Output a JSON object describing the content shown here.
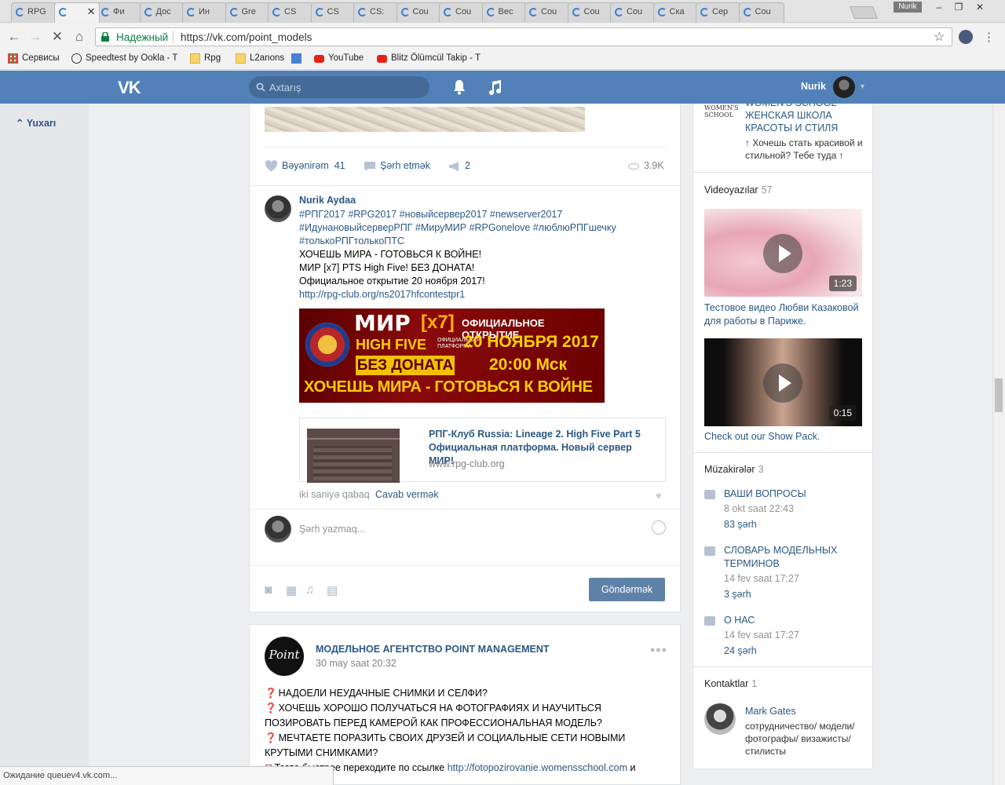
{
  "browser": {
    "tabs": [
      {
        "label": "RPG"
      },
      {
        "label": ""
      },
      {
        "label": "Фи"
      },
      {
        "label": "Дос"
      },
      {
        "label": "Ин"
      },
      {
        "label": "Gre"
      },
      {
        "label": "CS"
      },
      {
        "label": "CS"
      },
      {
        "label": "CS:"
      },
      {
        "label": "Cou"
      },
      {
        "label": "Cou"
      },
      {
        "label": "Bec"
      },
      {
        "label": "Cou"
      },
      {
        "label": "Cou"
      },
      {
        "label": "Cou"
      },
      {
        "label": "Ска"
      },
      {
        "label": "Сер"
      },
      {
        "label": "Cou"
      }
    ],
    "user_badge": "Nurik",
    "secure_label": "Надежный",
    "url": "https://vk.com/point_models",
    "bookmarks": [
      "Сервисы",
      "Speedtest by Ookla - T",
      "Rpg",
      "L2anons",
      "",
      "YouTube",
      "Blitz Ölümcül Takip - T"
    ],
    "status": "Ожидание queuev4.vk.com..."
  },
  "vk": {
    "search_placeholder": "Axtarış",
    "user_name": "Nurik",
    "up_label": "Yuxarı"
  },
  "post": {
    "like_label": "Bəyənirəm",
    "like_count": "41",
    "comment_label": "Şərh etmək",
    "share_count": "2",
    "views": "3.9K"
  },
  "comment": {
    "author": "Nurik Aydaa",
    "tags1": "#РПГ2017 #RPG2017 #новыйсервер2017 #newserver2017",
    "tags2": "#ИдунановыйсерверРПГ #МируМИР #RPGonelove #люблюРПГшечку",
    "tags3": "#толькоРПГтолькоПТС",
    "line1": "ХОЧЕШЬ МИРА - ГОТОВЬСЯ К ВОЙНЕ!",
    "line2": "МИР [x7] PTS High Five! БЕЗ ДОНАТА!",
    "line3": "Официальное открытие 20 ноября 2017!",
    "link": "http://rpg-club.org/ns2017hfcontestpr1",
    "banner": {
      "mir": "МИР",
      "x7": "[x7]",
      "open": "ОФИЦИАЛЬНОЕ ОТКРЫТИЕ",
      "hf": "HIGH FIVE",
      "hf_sub": "ОФИЦИАЛЬНАЯ ПЛАТФОРМА",
      "date": "20 НОЯБРЯ 2017",
      "nodon": "БЕЗ ДОНАТА",
      "time": "20:00 Мск",
      "war": "ХОЧЕШЬ МИРА - ГОТОВЬСЯ К ВОЙНЕ"
    },
    "link_card_title": "РПГ-Клуб Russia: Lineage 2. High Five Part 5 Официальная платформа. Новый сервер МИР!",
    "link_card_url": "www.rpg-club.org",
    "time": "iki saniyə qabaq",
    "reply": "Cavab vermək",
    "input_placeholder": "Şərh yazmaq...",
    "send": "Göndərmək"
  },
  "post2": {
    "logo_text": "Point",
    "name": "МОДЕЛЬНОЕ АГЕНТСТВО POINT MANAGEMENT",
    "date": "30 may saat 20:32",
    "p1": "НАДОЕЛИ НЕУДАЧНЫЕ СНИМКИ И СЕЛФИ?",
    "p2": "ХОЧЕШЬ ХОРОШО ПОЛУЧАТЬСЯ НА ФОТОГРАФИЯХ И НАУЧИТЬСЯ ПОЗИРОВАТЬ ПЕРЕД КАМЕРОЙ КАК ПРОФЕССИОНАЛЬНАЯ МОДЕЛЬ?",
    "p3": "МЕЧТАЕТЕ ПОРАЗИТЬ СВОИХ ДРУЗЕЙ И СОЦИАЛЬНЫЕ СЕТИ НОВЫМИ КРУТЫМИ СНИМКАМИ?",
    "p4_pre": "Тогда быстрее переходите по ссылке",
    "p4_link": "http://fotopozirovanie.womensschool.com",
    "p4_post": "и"
  },
  "sidebar": {
    "ad_brand": "WOMEN'S SCHOOL",
    "ad_title": "WOMEN'S SCHOOL ЖЕНСКАЯ ШКОЛА КРАСОТЫ И СТИЛЯ",
    "ad_desc": "↑ Хочешь стать красивой и стильной? Тебе туда ↑",
    "videos_title": "Videoyazılar",
    "videos_count": "57",
    "videos": [
      {
        "duration": "1:23",
        "title": "Тестовое видео Любви Казаковой для работы в Париже."
      },
      {
        "duration": "0:15",
        "title": "Check out our Show Pack."
      }
    ],
    "discussions_title": "Müzakirələr",
    "discussions_count": "3",
    "discussions": [
      {
        "title": "ВАШИ ВОПРОСЫ",
        "date": "8 okt saat 22:43",
        "count": "83 şərh"
      },
      {
        "title": "СЛОВАРЬ МОДЕЛЬНЫХ ТЕРМИНОВ",
        "date": "14 fev saat 17:27",
        "count": "3 şərh"
      },
      {
        "title": "О НАС",
        "date": "14 fev saat 17:27",
        "count": "24 şərh"
      }
    ],
    "contacts_title": "Kontaktlar",
    "contacts_count": "1",
    "contact_name": "Mark Gates",
    "contact_desc": "сотрудничество/ модели/ фотографы/ визажисты/ стилисты"
  }
}
